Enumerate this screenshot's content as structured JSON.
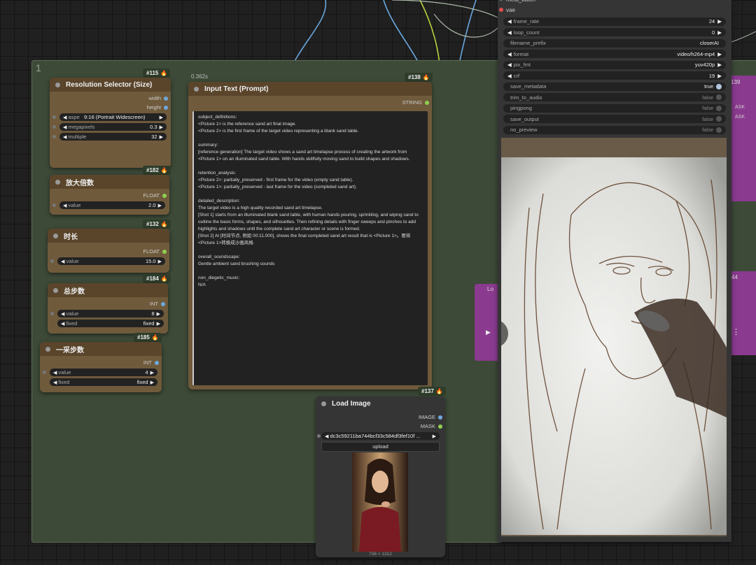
{
  "group": {
    "title": "1"
  },
  "nodes": {
    "resolution": {
      "id": "#115",
      "title": "Resolution Selector (Size)",
      "outputs": [
        "width",
        "height"
      ],
      "widgets": [
        {
          "label": "aspe",
          "value": "9:16 (Portrait Widescreen)"
        },
        {
          "label": "megapixels",
          "value": "0.3"
        },
        {
          "label": "multiple",
          "value": "32"
        }
      ]
    },
    "scale": {
      "id": "#182",
      "title": "放大倍数",
      "output": "FLOAT",
      "widget": {
        "label": "value",
        "value": "2.0"
      }
    },
    "duration": {
      "id": "#132",
      "title": "时长",
      "output": "FLOAT",
      "widget": {
        "label": "value",
        "value": "15.0"
      }
    },
    "steps": {
      "id": "#184",
      "title": "总步数",
      "output": "INT",
      "widgets": [
        {
          "label": "value",
          "value": "8"
        },
        {
          "label": "fixed",
          "value": "fixed"
        }
      ]
    },
    "step1": {
      "id": "#185",
      "title": "一采步数",
      "output": "INT",
      "widgets": [
        {
          "label": "value",
          "value": "4"
        },
        {
          "label": "fixed",
          "value": "fixed"
        }
      ]
    },
    "prompt": {
      "id": "#138",
      "title": "Input Text (Prompt)",
      "timing": "0.362s",
      "output": "STRING",
      "text": "subject_definitions:\n<Picture 1> is the reference sand art final image.\n<Picture 2> is the first frame of the target video representing a blank sand table.\n\nsummary:\n[reference generation] The target video shows a sand art timelapse process of creating the artwork from <Picture 1> on an illuminated sand table. With hands skillfully moving sand to build shapes and shadows.\n\nretention_analysis:\n<Picture 2>: partially_preserved - first frame for the video (empty sand table).\n<Picture 1>: partially_preserved - last frame for the video (completed sand art).\n\ndetailed_description:\nThe target video is a high quality recorded sand art timelapse.\n[Shot 1] starts from an illuminated blank sand table, with human hands pouring, sprinkling, and wiping sand to outline the basic forms, shapes, and silhouettes. Then refining details with finger sweeps and pinches to add highlights and shadows until the complete sand art character or scene is formed.\n[Shot 2] At [时间节点, 例如 00:11.000], shows the final completed sand art result that is <Picture 1>。要将 <Picture 1>转换成沙画风格.\n\noverall_soundscape:\nGentle ambient sand brushing sounds\n\nnon_diegetic_music:\nN/A"
    },
    "load_image": {
      "id": "#137",
      "title": "Load Image",
      "outputs": [
        "IMAGE",
        "MASK"
      ],
      "filename": "dc3c59211ba744bcf33c584df3fef10f ...",
      "upload_label": "upload",
      "caption": "736 × 1312"
    }
  },
  "vhs": {
    "inputs": [
      "meta_batch",
      "vae"
    ],
    "widgets": [
      {
        "label": "frame_rate",
        "value": "24",
        "kind": "num"
      },
      {
        "label": "loop_count",
        "value": "0",
        "kind": "num"
      },
      {
        "label": "filename_prefix",
        "value": "closerAI",
        "kind": "text"
      },
      {
        "label": "format",
        "value": "video/h264-mp4",
        "kind": "combo"
      },
      {
        "label": "pix_fmt",
        "value": "yuv420p",
        "kind": "combo"
      },
      {
        "label": "crf",
        "value": "19",
        "kind": "num"
      },
      {
        "label": "save_metadata",
        "value": "true",
        "kind": "toggle-on"
      },
      {
        "label": "trim_to_audio",
        "value": "false",
        "kind": "toggle"
      },
      {
        "label": "pingpong",
        "value": "false",
        "kind": "toggle"
      },
      {
        "label": "save_output",
        "value": "false",
        "kind": "toggle"
      },
      {
        "label": "no_preview",
        "value": "false",
        "kind": "toggle"
      }
    ]
  },
  "side_nodes": {
    "partial_badge_1": "139",
    "partial_badge_2": "44",
    "partial_title": "Lo",
    "partial_labels": [
      "ASK",
      "ASK"
    ]
  },
  "colors": {
    "node_body": "#6f5a3b",
    "node_header": "#5a452b",
    "group": "#3d4a38",
    "wire_blue": "#4e9ad8",
    "wire_green": "#8fd050",
    "wire_yellowgreen": "#b4d43c",
    "wire_purple": "#9b3fa0"
  },
  "icons": [
    "fire-icon",
    "left-arrow-icon",
    "right-arrow-icon",
    "play-icon",
    "more-icon",
    "toggle-icon"
  ]
}
